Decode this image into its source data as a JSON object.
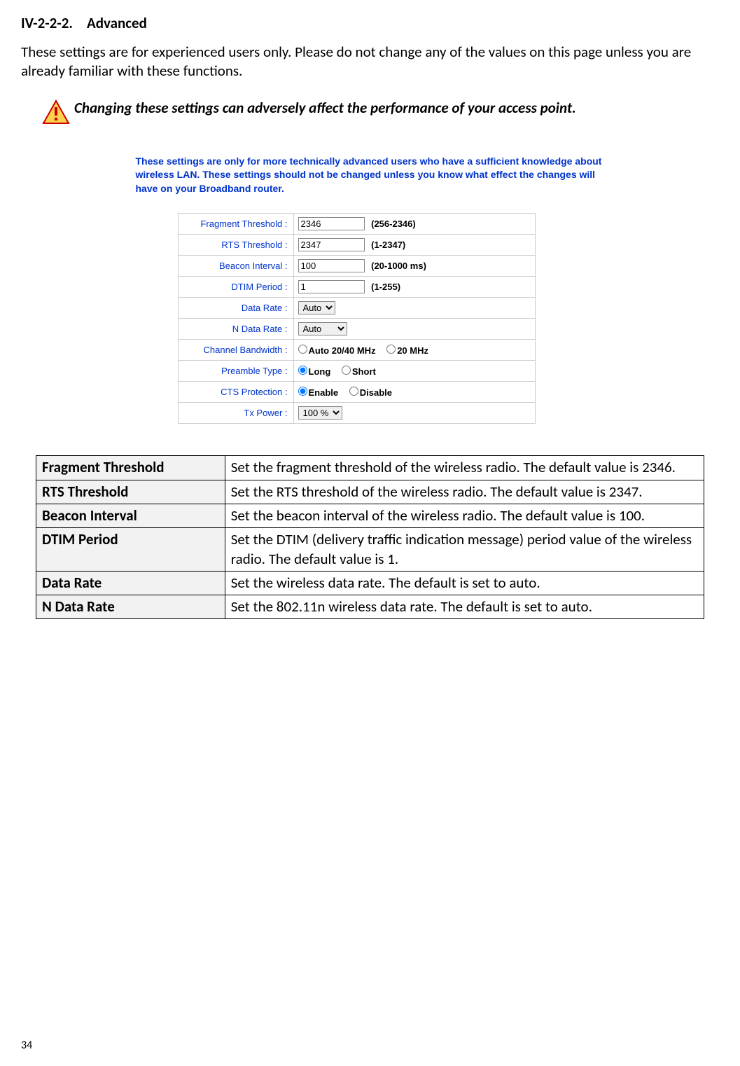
{
  "heading": {
    "number": "IV-2-2-2.",
    "title": "Advanced"
  },
  "intro": "These settings are for experienced users only. Please do not change any of the values on this page unless you are already familiar with these functions.",
  "warning": "Changing these settings can adversely affect the performance of your access point.",
  "screenshot": {
    "desc": "These settings are only for more technically advanced users who have a sufficient knowledge about wireless LAN. These settings should not be changed unless you know what effect the changes will have on your Broadband router.",
    "rows": {
      "fragment": {
        "label": "Fragment Threshold :",
        "value": "2346",
        "range": "(256-2346)"
      },
      "rts": {
        "label": "RTS Threshold :",
        "value": "2347",
        "range": "(1-2347)"
      },
      "beacon": {
        "label": "Beacon Interval :",
        "value": "100",
        "range": "(20-1000 ms)"
      },
      "dtim": {
        "label": "DTIM Period :",
        "value": "1",
        "range": "(1-255)"
      },
      "datarate": {
        "label": "Data Rate :",
        "value": "Auto"
      },
      "ndatarate": {
        "label": "N Data Rate :",
        "value": "Auto"
      },
      "channelbw": {
        "label": "Channel Bandwidth :",
        "opt1": "Auto 20/40 MHz",
        "opt2": "20 MHz"
      },
      "preamble": {
        "label": "Preamble Type :",
        "opt1": "Long",
        "opt2": "Short"
      },
      "cts": {
        "label": "CTS Protection :",
        "opt1": "Enable",
        "opt2": "Disable"
      },
      "txpower": {
        "label": "Tx Power :",
        "value": "100 %"
      }
    }
  },
  "desc": [
    {
      "term": "Fragment Threshold",
      "def": "Set the fragment threshold of the wireless radio. The default value is 2346."
    },
    {
      "term": "RTS Threshold",
      "def": "Set the RTS threshold of the wireless radio. The default value is 2347."
    },
    {
      "term": "Beacon Interval",
      "def": "Set the beacon interval of the wireless radio. The default value is 100."
    },
    {
      "term": "DTIM Period",
      "def": "Set the DTIM (delivery traffic indication message) period value of the wireless radio. The default value is 1."
    },
    {
      "term": "Data Rate",
      "def": "Set the wireless data rate. The default is set to auto."
    },
    {
      "term": "N Data Rate",
      "def": "Set the 802.11n wireless data rate. The default is set to auto."
    }
  ],
  "pageNumber": "34"
}
